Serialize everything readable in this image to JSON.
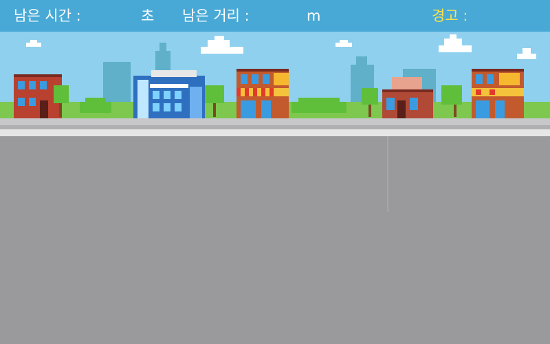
{
  "hud": {
    "time_label": "남은 시간 :",
    "time_value": "",
    "time_unit": "초",
    "distance_label": "남은 거리 :",
    "distance_value": "",
    "distance_unit": "m",
    "warning_label": "경고 :",
    "warning_value": ""
  },
  "colors": {
    "hud_background": "#48a9d6",
    "hud_text": "#ffffff",
    "warning_text": "#ffe14a",
    "sky": "#8fd0ee",
    "road": "#9a9a9c"
  },
  "scene": {
    "buildings": [
      {
        "name": "red-brick-building"
      },
      {
        "name": "blue-glass-building"
      },
      {
        "name": "orange-shop-building"
      },
      {
        "name": "pink-roof-house"
      },
      {
        "name": "yellow-shop-building"
      }
    ]
  }
}
